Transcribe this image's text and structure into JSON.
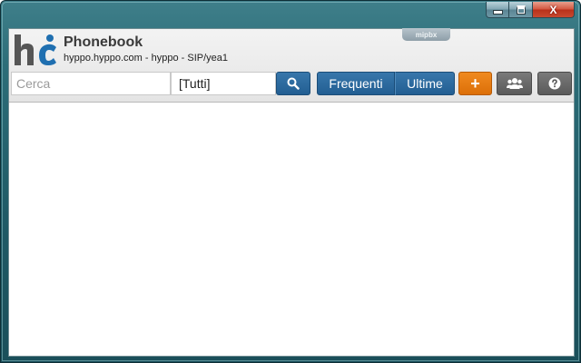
{
  "window": {
    "caption_buttons": {
      "minimize_icon": "minimize-icon",
      "maximize_icon": "maximize-icon",
      "close_glyph": "X"
    }
  },
  "app": {
    "logo_icon": "hc-logo",
    "title": "Phonebook",
    "subtitle": "hyppo.hyppo.com - hyppo - SIP/yea1",
    "tag": "mipbx"
  },
  "toolbar": {
    "search_placeholder": "Cerca",
    "search_value": "",
    "filter_value": "[Tutti]",
    "search_button_icon": "search-icon",
    "frequent_label": "Frequenti",
    "recent_label": "Ultime",
    "add_label": "+",
    "group_icon": "group-icon",
    "help_icon": "question-icon"
  },
  "colors": {
    "accent_blue": "#225e92",
    "accent_orange": "#dc6f08",
    "neutral_gray": "#5a5a5a"
  }
}
